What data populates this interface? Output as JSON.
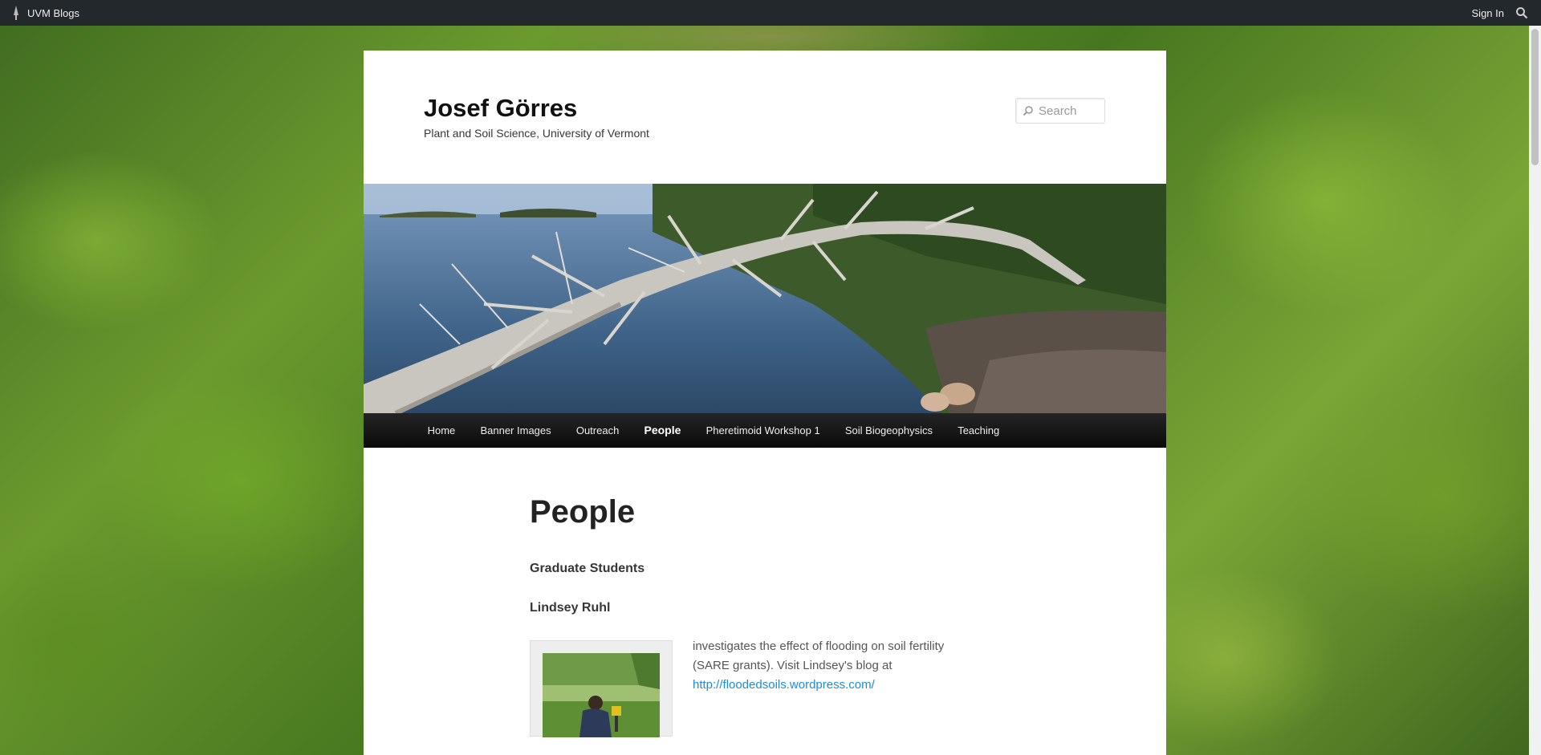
{
  "adminbar": {
    "brand_label": "UVM Blogs",
    "signin_label": "Sign In"
  },
  "site": {
    "title": "Josef Görres",
    "description": "Plant and Soil Science, University of Vermont"
  },
  "search": {
    "placeholder": "Search"
  },
  "nav": {
    "items": [
      {
        "label": "Home"
      },
      {
        "label": "Banner Images"
      },
      {
        "label": "Outreach"
      },
      {
        "label": "People",
        "active": true
      },
      {
        "label": "Pheretimoid Workshop 1"
      },
      {
        "label": "Soil Biogeophysics"
      },
      {
        "label": "Teaching"
      }
    ]
  },
  "content": {
    "title": "People",
    "section_heading": "Graduate Students",
    "person": {
      "name": "Lindsey Ruhl",
      "description": "investigates the effect of flooding on soil fertility (SARE grants). Visit Lindsey's blog at",
      "link_text": "http://floodedsoils.wordpress.com/"
    }
  },
  "colors": {
    "adminbar_bg": "#23282d",
    "nav_bg": "#0a0a0a",
    "link": "#1b8be0"
  },
  "icons": [
    "uvm-logo-icon",
    "search-icon",
    "search-field-icon"
  ]
}
